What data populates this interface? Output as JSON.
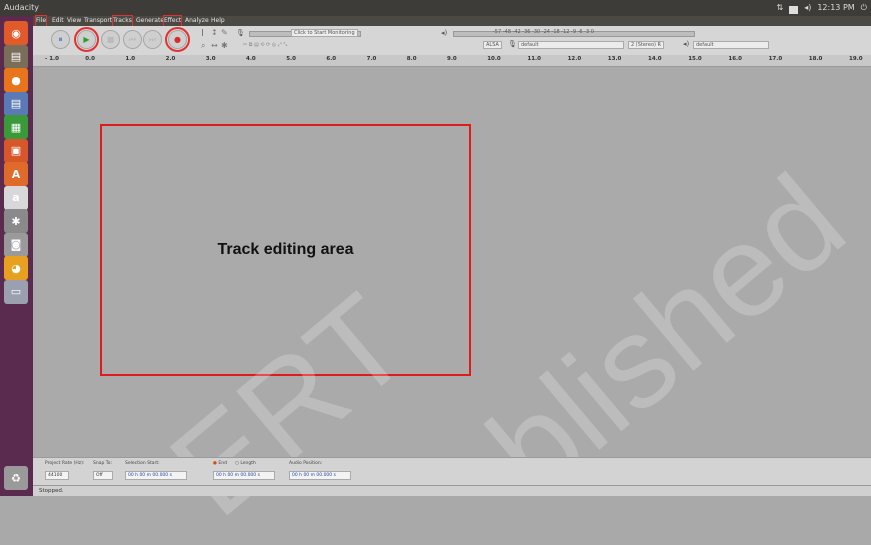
{
  "window": {
    "title": "Audacity",
    "clock": "12:13 PM"
  },
  "launcher": [
    {
      "name": "ubuntu-dash-icon",
      "glyph": "◉",
      "color": "#e05a2a"
    },
    {
      "name": "files-icon",
      "glyph": "▤",
      "color": "#7a6e5a"
    },
    {
      "name": "firefox-icon",
      "glyph": "●",
      "color": "#e8741c"
    },
    {
      "name": "text-editor-icon",
      "glyph": "▤",
      "color": "#5a7ab5"
    },
    {
      "name": "spreadsheet-icon",
      "glyph": "▦",
      "color": "#3a9a3a"
    },
    {
      "name": "presentation-icon",
      "glyph": "▣",
      "color": "#d8572a"
    },
    {
      "name": "software-center-icon",
      "glyph": "A",
      "color": "#e06a2a"
    },
    {
      "name": "amazon-icon",
      "glyph": "a",
      "color": "#d8d8d8"
    },
    {
      "name": "settings-icon",
      "glyph": "✱",
      "color": "#8a8a8a"
    },
    {
      "name": "camera-icon",
      "glyph": "◙",
      "color": "#9a9a9a"
    },
    {
      "name": "audacity-icon",
      "glyph": "◕",
      "color": "#e8a020"
    },
    {
      "name": "screen-icon",
      "glyph": "▭",
      "color": "#9aa0b0"
    },
    {
      "name": "trash-icon",
      "glyph": "♻",
      "color": "#9a9a9a"
    }
  ],
  "menu": [
    "File",
    "Edit",
    "View",
    "Transport",
    "Tracks",
    "Generate",
    "Effect",
    "Analyze",
    "Help"
  ],
  "menu_highlight": [
    "File",
    "Tracks",
    "Effect"
  ],
  "toolbar": {
    "buttons": [
      {
        "name": "pause-button",
        "glyph": "⏸",
        "color": "#4466cc"
      },
      {
        "name": "play-button",
        "glyph": "▶",
        "color": "#2aa02a"
      },
      {
        "name": "stop-button",
        "glyph": "■",
        "color": "#bbbbbb"
      },
      {
        "name": "skip-start-button",
        "glyph": "⏮",
        "color": "#bbbbbb"
      },
      {
        "name": "skip-end-button",
        "glyph": "⏭",
        "color": "#bbbbbb"
      },
      {
        "name": "record-button",
        "glyph": "●",
        "color": "#d82a2a"
      }
    ],
    "monitor_label": "Click to Start Monitoring",
    "host": "ALSA",
    "input_device": "default",
    "channels": "2 (Stereo) R",
    "output_device": "default",
    "meter_ticks": [
      "-57",
      "-48",
      "-42",
      "-36",
      "-30",
      "-24",
      "-18",
      "-12",
      "-9",
      "-6",
      "-3",
      "0"
    ]
  },
  "ruler": [
    "- 1.0",
    "0.0",
    "1.0",
    "2.0",
    "3.0",
    "4.0",
    "5.0",
    "6.0",
    "7.0",
    "8.0",
    "9.0",
    "10.0",
    "11.0",
    "12.0",
    "13.0",
    "14.0",
    "15.0",
    "16.0",
    "17.0",
    "18.0",
    "19.0"
  ],
  "track_area": {
    "label": "Track editing area"
  },
  "selection": {
    "project_rate_label": "Project Rate (Hz):",
    "project_rate": "44100",
    "snap_label": "Snap To:",
    "snap_value": "Off",
    "selection_start_label": "Selection Start:",
    "end_label": "End",
    "length_label": "Length",
    "audio_position_label": "Audio Position:",
    "start_value": "00 h 00 m 00.000 s",
    "end_value": "00 h 00 m 00.000 s",
    "position_value": "00 h 00 m 00.000 s"
  },
  "status": {
    "text": "Stopped."
  },
  "watermark": {
    "text1": "ERT",
    "text2": "blished"
  }
}
